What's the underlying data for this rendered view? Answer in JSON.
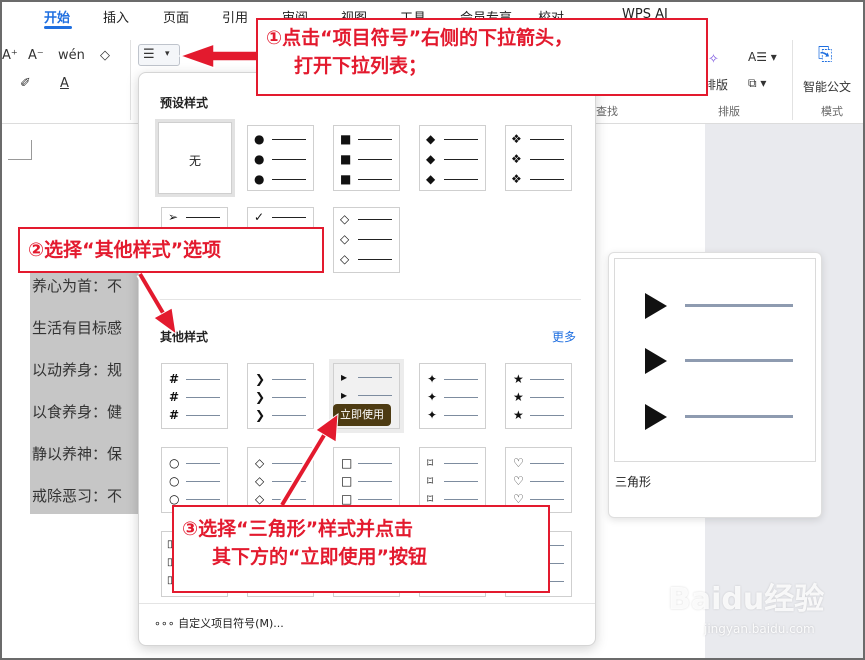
{
  "tabs": [
    "开始",
    "插入",
    "页面",
    "引用",
    "审阅",
    "视图",
    "工具",
    "会员专享",
    "校对",
    "WPS AI"
  ],
  "ribbon": {
    "font_buttons": [
      "A⁺",
      "A⁻",
      "wén",
      "◇"
    ],
    "font_row2": [
      "✐",
      "A"
    ],
    "find_group": "查找",
    "layout_button": "排版",
    "layout_group": "排版",
    "smart_doc": "智能公文",
    "mode_group": "模式"
  },
  "bullet_button": {
    "icon": "list-bullets-icon",
    "arrow": "chevron-down-icon"
  },
  "document": {
    "lines": [
      "养心为首：不",
      "生活有目标感",
      "以动养身：规",
      "以食养身：健",
      "静以养神：保",
      "戒除恶习：不"
    ]
  },
  "dropdown": {
    "preset_title": "预设样式",
    "none_label": "无",
    "other_title": "其他样式",
    "more_label": "更多",
    "use_now": "立即使用",
    "custom_label": "自定义项目符号(M)...",
    "presets_row1": [
      "●",
      "■",
      "◆",
      "❖"
    ],
    "presets_row2": [
      "➢",
      "✓",
      "◇"
    ],
    "others_row1": [
      "#",
      "❯",
      "▸",
      "✦",
      "★"
    ],
    "others_row2": [
      "○",
      "◇",
      "□",
      "⌑",
      "♡"
    ]
  },
  "preview": {
    "label": "三角形"
  },
  "callouts": {
    "c1_line1": "①点击“项目符号”右侧的下拉箭头，",
    "c1_line2": "打开下拉列表；",
    "c2": "②选择“其他样式”选项",
    "c3_line1": "③选择“三角形”样式并点击",
    "c3_line2": "其下方的“立即使用”按钮"
  },
  "watermark": {
    "main": "Baidu经验",
    "sub": "jingyan.baidu.com"
  },
  "colors": {
    "accent": "#1f6fe0",
    "callout": "#e31a2e",
    "selection": "#c6c6c6"
  }
}
